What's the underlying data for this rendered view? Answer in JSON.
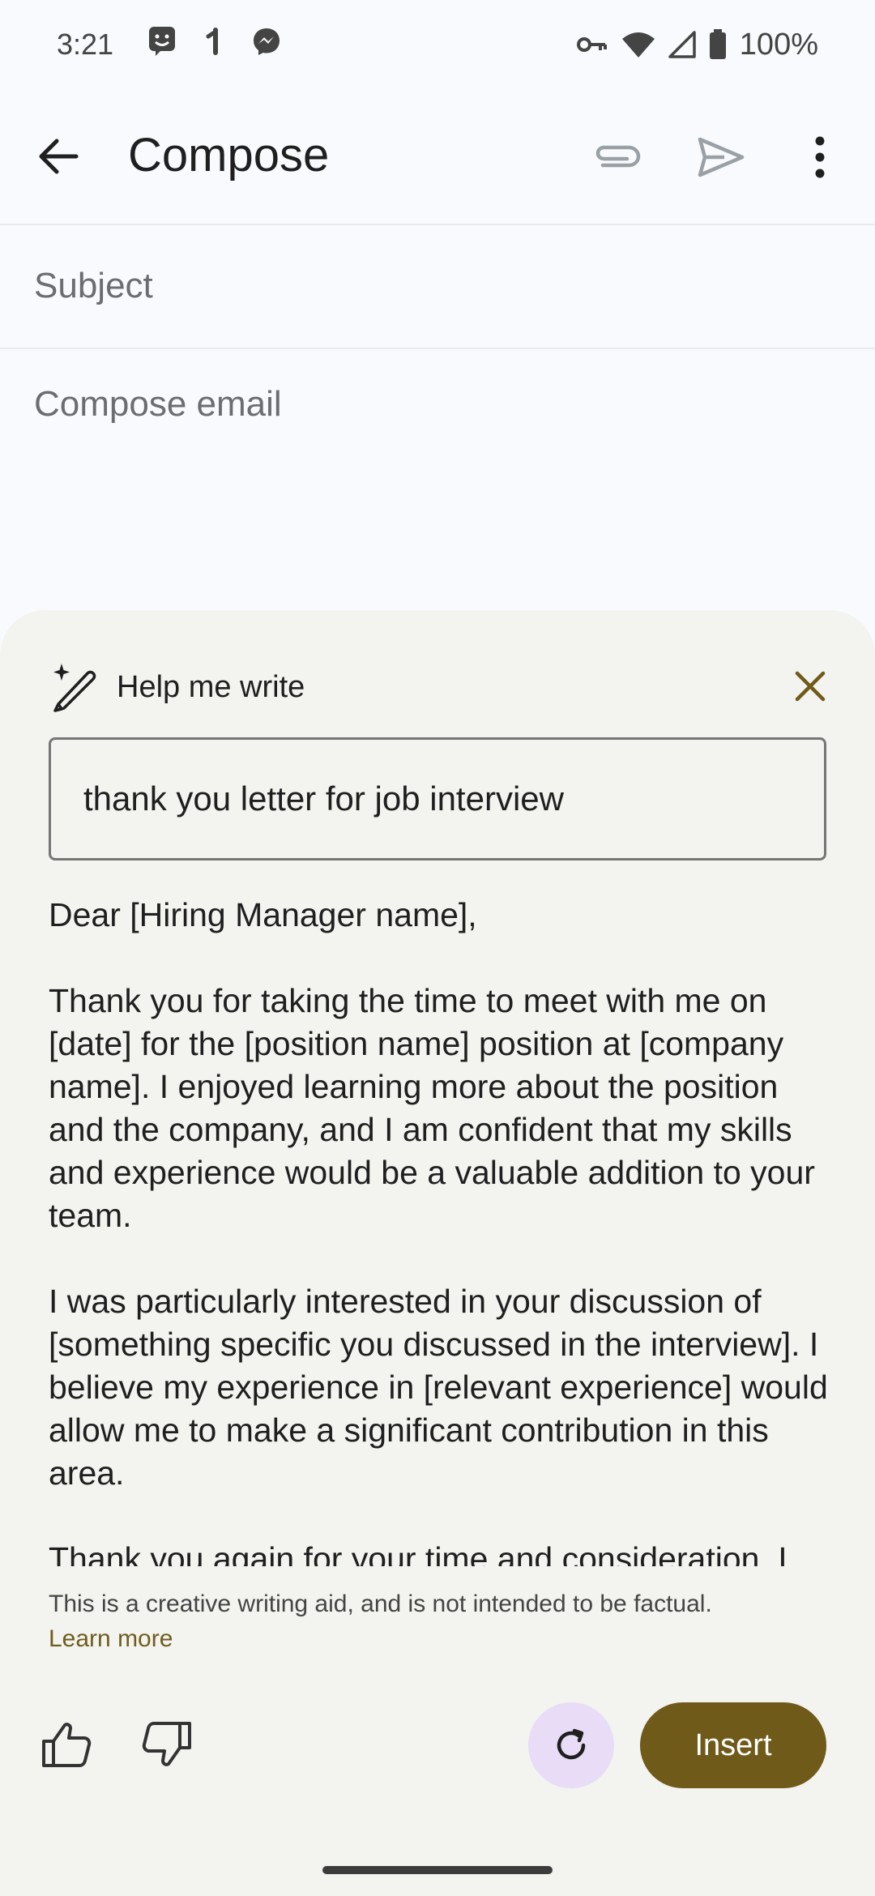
{
  "status_bar": {
    "time": "3:21",
    "battery": "100%"
  },
  "app_bar": {
    "title": "Compose"
  },
  "compose": {
    "subject_placeholder": "Subject",
    "body_placeholder": "Compose email"
  },
  "help_me_write": {
    "title": "Help me write",
    "prompt": "thank you letter for job interview",
    "draft": [
      "Dear [Hiring Manager name],",
      "Thank you for taking the time to meet with me on [date] for the [position name] position at [company name]. I enjoyed learning more about the position and the company, and I am confident that my skills and experience would be a valuable addition to your team.",
      "I was particularly interested in your discussion of [something specific you discussed in the interview]. I believe my experience in [relevant experience] would allow me to make a significant contribution in this area.",
      "Thank you again for your time and consideration. I"
    ],
    "disclaimer": "This is a creative writing aid, and is not intended to be factual.",
    "learn_more": "Learn more",
    "insert_label": "Insert"
  },
  "colors": {
    "accent": "#705a1a",
    "sheet_bg": "#f3f3f0",
    "regen_bg": "#e8dcf6"
  },
  "icons": [
    "back-arrow-icon",
    "paperclip-icon",
    "send-icon",
    "more-vert-icon",
    "pen-sparkle-icon",
    "close-icon",
    "thumb-up-icon",
    "thumb-down-icon",
    "refresh-icon"
  ]
}
